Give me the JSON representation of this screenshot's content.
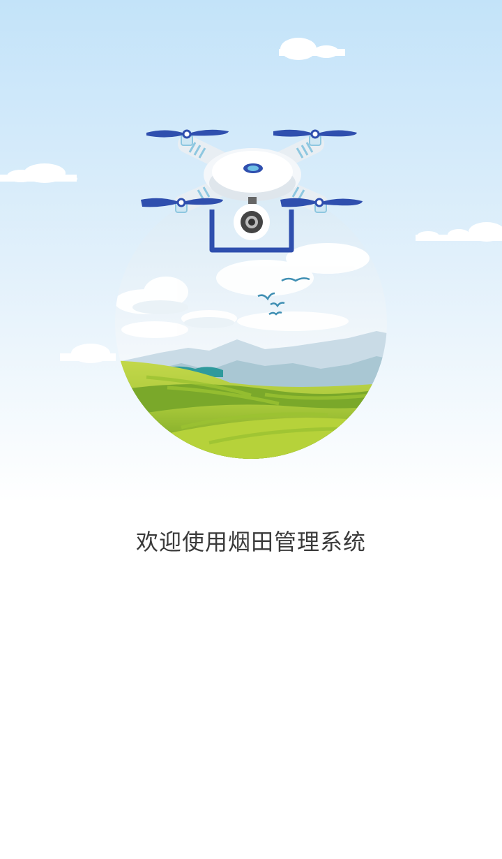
{
  "splash": {
    "welcome_text": "欢迎使用烟田管理系统",
    "illustration_icon": "drone-over-field-illustration"
  },
  "colors": {
    "sky_top": "#bfe0f8",
    "sky_bottom": "#ffffff",
    "drone_blue": "#2f4fae",
    "field_green": "#8cbf2a",
    "text": "#3a3a3a"
  }
}
